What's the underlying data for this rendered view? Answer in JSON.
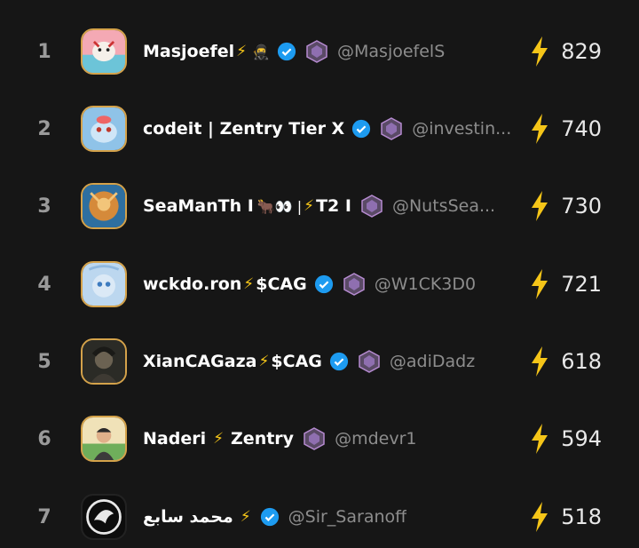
{
  "leaderboard": [
    {
      "rank": "1",
      "name": "Masjoefel",
      "suffix": "🥷",
      "handle": "@MasjoefelS",
      "score": "829",
      "verified": true
    },
    {
      "rank": "2",
      "name": "codeit | Zentry Tier X",
      "suffix": "",
      "handle": "@investin...",
      "score": "740",
      "verified": true
    },
    {
      "rank": "3",
      "name": "SeaManTh I",
      "mid": "🐂👀 |",
      "name2": "T2 I",
      "handle": "@NutsSea...",
      "score": "730",
      "verified": false
    },
    {
      "rank": "4",
      "name": "wckdo.ron",
      "name2": "$CAG",
      "handle": "@W1CK3D0",
      "score": "721",
      "verified": true
    },
    {
      "rank": "5",
      "name": "XianCAGaza",
      "name2": "$CAG",
      "handle": "@adiDadz",
      "score": "618",
      "verified": true
    },
    {
      "rank": "6",
      "name": "Naderi",
      "name2": "Zentry",
      "handle": "@mdevr1",
      "score": "594",
      "verified": false
    },
    {
      "rank": "7",
      "name": "محمد سابع",
      "handle": "@Sir_Saranoff",
      "score": "518",
      "verified": true
    }
  ],
  "icons": {
    "bolt": "lightning-bolt-icon",
    "verified": "verified-check-icon",
    "badge": "tier-badge-icon"
  },
  "colors": {
    "background": "#161616",
    "bolt": "#f5c518",
    "verified": "#1d9bf0",
    "avatar_border": "#d4a24a"
  }
}
